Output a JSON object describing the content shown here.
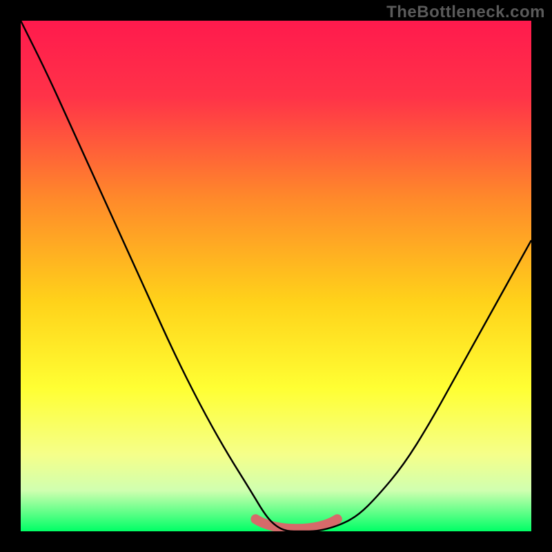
{
  "watermark": "TheBottleneck.com",
  "colors": {
    "frame": "#000000",
    "watermark": "#5a5a5a",
    "curve": "#000000",
    "bottom_highlight": "#d66a6a",
    "gradient_stops": [
      {
        "offset": 0.0,
        "color": "#ff1a4d"
      },
      {
        "offset": 0.15,
        "color": "#ff3348"
      },
      {
        "offset": 0.35,
        "color": "#ff8a2a"
      },
      {
        "offset": 0.55,
        "color": "#ffd21a"
      },
      {
        "offset": 0.72,
        "color": "#ffff33"
      },
      {
        "offset": 0.85,
        "color": "#f5ff8a"
      },
      {
        "offset": 0.92,
        "color": "#d0ffb0"
      },
      {
        "offset": 1.0,
        "color": "#00ff66"
      }
    ]
  },
  "chart_data": {
    "type": "line",
    "title": "",
    "xlabel": "",
    "ylabel": "",
    "xlim": [
      0,
      100
    ],
    "ylim": [
      0,
      100
    ],
    "x": [
      0,
      5,
      10,
      15,
      20,
      25,
      30,
      35,
      40,
      45,
      48,
      50,
      52,
      55,
      58,
      62,
      66,
      70,
      75,
      80,
      85,
      90,
      95,
      100
    ],
    "values": [
      100,
      90,
      79,
      68,
      57,
      46,
      35,
      25,
      16,
      8,
      3,
      1,
      0,
      0,
      0,
      1,
      3,
      7,
      13,
      21,
      30,
      39,
      48,
      57
    ],
    "minimum_plateau_x": [
      49,
      59
    ],
    "note": "V-shaped bottleneck curve; y≈0 is optimal (green), high y is worse (red). Values estimated from pixel positions on a 0–100 normalized grid."
  }
}
